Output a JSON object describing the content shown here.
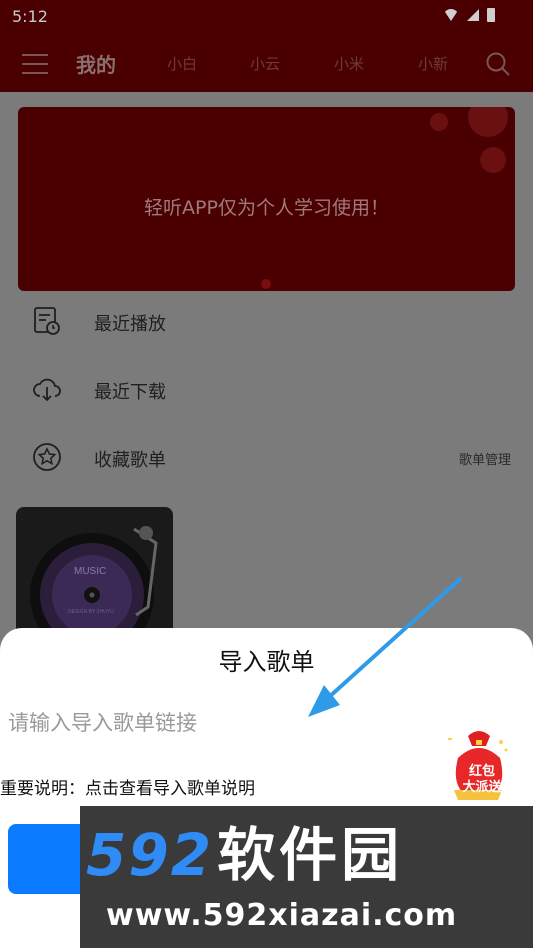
{
  "status_bar": {
    "time": "5:12"
  },
  "app_bar": {
    "active_tab": "我的",
    "tabs": [
      "小白",
      "小云",
      "小米",
      "小新"
    ]
  },
  "banner": {
    "text": "轻听APP仅为个人学习使用！"
  },
  "menu": {
    "items": [
      {
        "label": "最近播放",
        "icon": "recent-play-icon"
      },
      {
        "label": "最近下载",
        "icon": "cloud-download-icon"
      },
      {
        "label": "收藏歌单",
        "icon": "star-icon"
      }
    ],
    "manage_label": "歌单管理"
  },
  "album_card": {
    "title": "MUSIC",
    "subtitle": "DESIGN BY ZHUYU"
  },
  "dialog": {
    "title": "导入歌单",
    "input": {
      "value": "",
      "placeholder": "请输入导入歌单链接"
    },
    "notice_prefix": "重要说明：",
    "notice_link": "点击查看导入歌单说明"
  },
  "ad": {
    "line1": "红包",
    "line2": "大派送"
  },
  "watermark": {
    "brand_number": "592",
    "brand_name": "软件园",
    "url": "www.592xiazai.com"
  },
  "colors": {
    "app_bar_dimmed": "#4a0000",
    "primary_button": "#0a7aff",
    "arrow": "#2f9be8",
    "watermark_blue": "#2f8cf7"
  }
}
